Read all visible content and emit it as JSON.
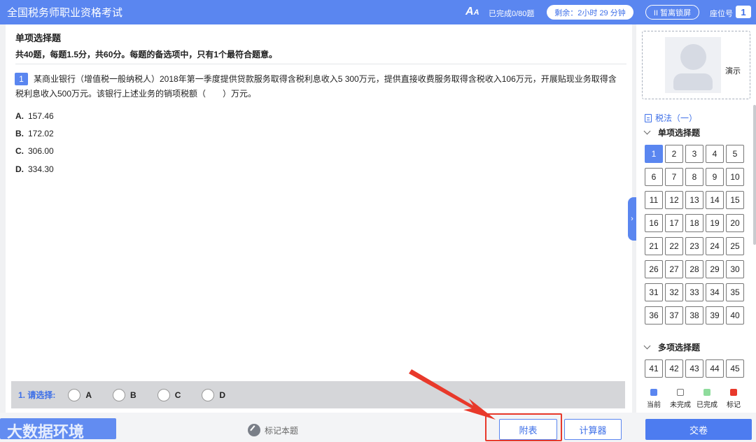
{
  "header": {
    "title": "全国税务师职业资格考试",
    "font_icon": "font-size-icon",
    "progress": "已完成0/80题",
    "timer": "剩余：2小时 29 分钟",
    "lock_label": "II 暂离锁屏",
    "seat_label": "座位号",
    "seat_number": "1"
  },
  "question": {
    "section_title": "单项选择题",
    "section_desc": "共40题，每题1.5分，共60分。每题的备选项中，只有1个最符合题意。",
    "number": "1",
    "text": "某商业银行（增值税一般纳税人）2018年第一季度提供贷款服务取得含税利息收入5 300万元，提供直接收费服务取得含税收入106万元，开展贴现业务取得含税利息收入500万元。该银行上述业务的销项税额（　　）万元。",
    "options": [
      {
        "letter": "A.",
        "text": "157.46"
      },
      {
        "letter": "B.",
        "text": "172.02"
      },
      {
        "letter": "C.",
        "text": "306.00"
      },
      {
        "letter": "D.",
        "text": "334.30"
      }
    ]
  },
  "answer_bar": {
    "label": "1. 请选择:",
    "choices": [
      "A",
      "B",
      "C",
      "D"
    ]
  },
  "side_tab_glyph": "›",
  "sidebar": {
    "candidate_name": "演示",
    "paper_title": "税法（一）",
    "groups": [
      {
        "title": "单项选择题",
        "numbers": [
          "1",
          "2",
          "3",
          "4",
          "5",
          "6",
          "7",
          "8",
          "9",
          "10",
          "11",
          "12",
          "13",
          "14",
          "15",
          "16",
          "17",
          "18",
          "19",
          "20",
          "21",
          "22",
          "23",
          "24",
          "25",
          "26",
          "27",
          "28",
          "29",
          "30",
          "31",
          "32",
          "33",
          "34",
          "35",
          "36",
          "37",
          "38",
          "39",
          "40"
        ]
      },
      {
        "title": "多项选择题",
        "numbers": [
          "41",
          "42",
          "43",
          "44",
          "45"
        ]
      }
    ],
    "legend": [
      {
        "label": "当前",
        "color": "#5a86f0"
      },
      {
        "label": "未完成",
        "color": "#ffffff"
      },
      {
        "label": "已完成",
        "color": "#8fdc9c"
      },
      {
        "label": "标记",
        "color": "#e8392b"
      }
    ]
  },
  "footer": {
    "prev_label": "",
    "watermark": "大数据环境",
    "mark_label": "标记本题",
    "appendix_label": "附表",
    "calculator_label": "计算器",
    "submit_label": "交卷"
  },
  "colors": {
    "primary": "#5a86f0",
    "annotation": "#e8392b"
  }
}
